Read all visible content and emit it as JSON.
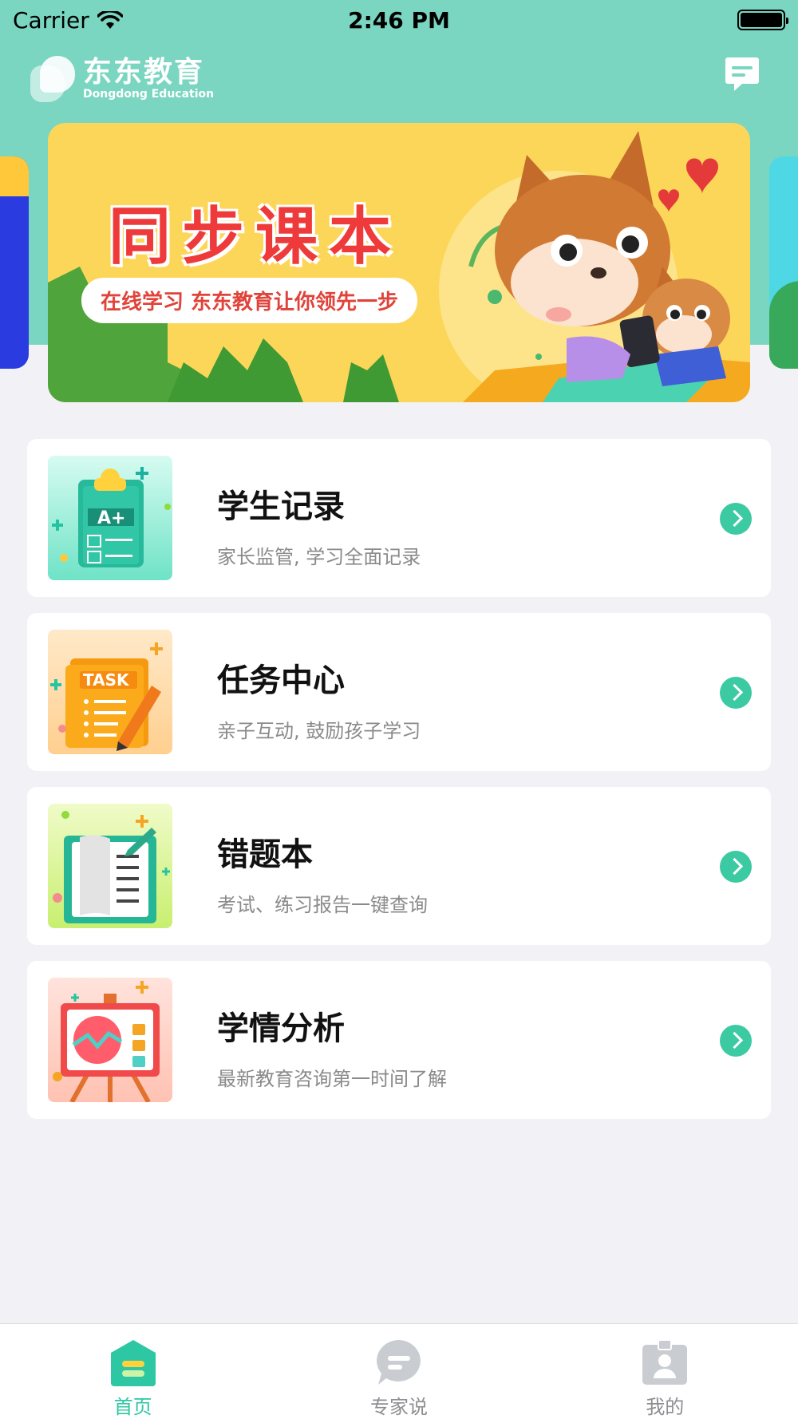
{
  "status_bar": {
    "carrier": "Carrier",
    "time": "2:46 PM"
  },
  "header": {
    "brand_name": "东东教育",
    "brand_sub": "Dongdong Education",
    "message_icon": "message-icon"
  },
  "banner": {
    "title": "同步课本",
    "tagline": "在线学习 东东教育让你领先一步"
  },
  "cards": [
    {
      "title": "学生记录",
      "desc": "家长监管, 学习全面记录",
      "icon": "clipboard-grade-icon"
    },
    {
      "title": "任务中心",
      "desc": "亲子互动, 鼓励孩子学习",
      "icon": "task-notebook-icon"
    },
    {
      "title": "错题本",
      "desc": "考试、练习报告一键查询",
      "icon": "error-book-icon"
    },
    {
      "title": "学情分析",
      "desc": "最新教育咨询第一时间了解",
      "icon": "analysis-board-icon"
    }
  ],
  "tab_bar": {
    "items": [
      {
        "label": "首页",
        "icon": "home-icon",
        "active": true
      },
      {
        "label": "专家说",
        "icon": "chat-bubble-icon",
        "active": false
      },
      {
        "label": "我的",
        "icon": "profile-badge-icon",
        "active": false
      }
    ]
  },
  "colors": {
    "accent": "#2ec7a4",
    "header_bg": "#7ad5c1",
    "banner_bg": "#fcd659",
    "banner_title": "#ee3a3a"
  }
}
